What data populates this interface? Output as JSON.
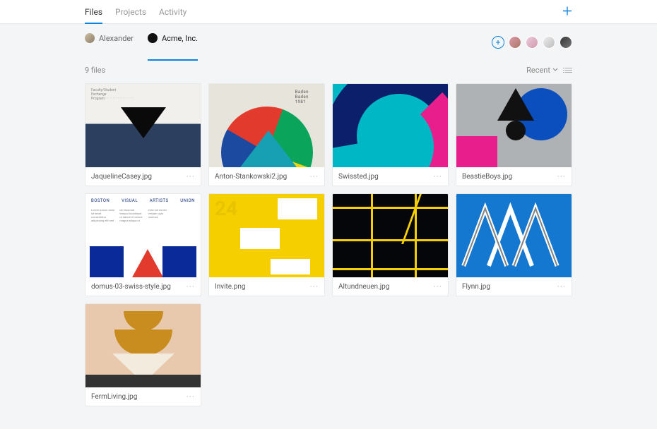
{
  "nav": {
    "tabs": [
      {
        "label": "Files",
        "active": true
      },
      {
        "label": "Projects",
        "active": false
      },
      {
        "label": "Activity",
        "active": false
      }
    ]
  },
  "orgs": [
    {
      "label": "Alexander",
      "active": false
    },
    {
      "label": "Acme, Inc.",
      "active": true
    }
  ],
  "filter": {
    "count_label": "9 files",
    "sort_label": "Recent"
  },
  "collaborators": {
    "count": 4
  },
  "files": [
    {
      "name": "JaquelineCasey.jpg"
    },
    {
      "name": "Anton-Stankowski2.jpg"
    },
    {
      "name": "Swissted.jpg"
    },
    {
      "name": "BeastieBoys.jpg"
    },
    {
      "name": "domus-03-swiss-style.jpg"
    },
    {
      "name": "Invite.png"
    },
    {
      "name": "Altundneuen.jpg"
    },
    {
      "name": "Flynn.jpg"
    },
    {
      "name": "FermLiving.jpg"
    }
  ],
  "thumb_text": {
    "stankowski": "Baden\nBaden\n1981",
    "domus_header": [
      "BOSTON",
      "VISUAL",
      "ARTISTS",
      "UNION"
    ],
    "invite_num": "24"
  }
}
